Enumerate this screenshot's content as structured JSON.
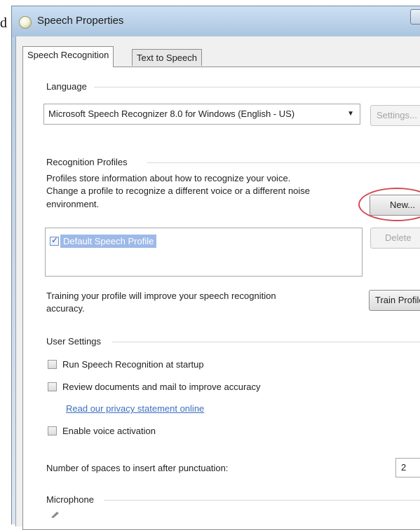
{
  "stray_char": "d",
  "window": {
    "title": "Speech Properties"
  },
  "tabs": [
    {
      "label": "Speech Recognition",
      "active": true
    },
    {
      "label": "Text to Speech",
      "active": false
    }
  ],
  "language": {
    "group_label": "Language",
    "selected": "Microsoft Speech Recognizer 8.0 for Windows (English - US)",
    "settings_button": "Settings..."
  },
  "profiles": {
    "group_label": "Recognition Profiles",
    "description_1": "Profiles store information about how to recognize your voice.",
    "description_2": "Change a profile to recognize a different voice or a different noise",
    "description_3": "environment.",
    "new_button": "New...",
    "delete_button": "Delete",
    "items": [
      {
        "label": "Default Speech Profile",
        "checked": true
      }
    ],
    "training_text_1": "Training your profile will improve your speech recognition",
    "training_text_2": "accuracy.",
    "train_button": "Train Profile..."
  },
  "user_settings": {
    "group_label": "User Settings",
    "run_at_startup": "Run Speech Recognition at startup",
    "review_documents": "Review documents and mail to improve accuracy",
    "privacy_link": "Read our privacy statement online",
    "voice_activation": "Enable voice activation",
    "spaces_label": "Number of spaces to insert after punctuation:",
    "spaces_value": "2"
  },
  "microphone": {
    "group_label": "Microphone"
  },
  "colors": {
    "annotation_circle": "#d44a53",
    "selection": "#9db9e8",
    "link": "#3d6fc0"
  }
}
